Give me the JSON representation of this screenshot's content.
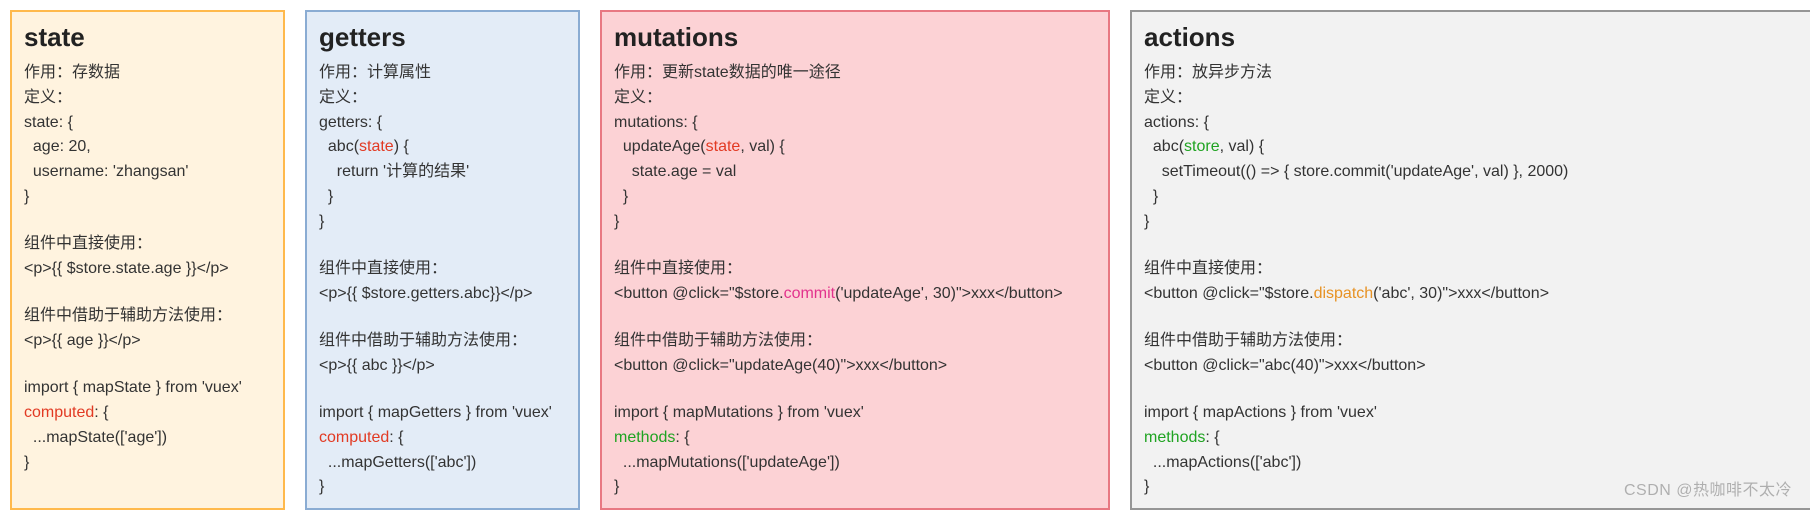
{
  "watermark": "CSDN @热咖啡不太冷",
  "cards": {
    "state": {
      "title": "state",
      "purpose": "作用：存数据",
      "define_label": "定义：",
      "def1": "state: {",
      "def2": "  age: 20,",
      "def3": "  username: 'zhangsan'",
      "def4": "}",
      "direct_label": "组件中直接使用：",
      "direct_code": "<p>{{ $store.state.age }}</p>",
      "helper_label": "组件中借助于辅助方法使用：",
      "helper_code": "<p>{{ age }}</p>",
      "import_code": "import { mapState } from 'vuex'",
      "computed": "computed",
      "computed_after": ": {",
      "map_code": "  ...mapState(['age'])",
      "close": "}"
    },
    "getters": {
      "title": "getters",
      "purpose": "作用：计算属性",
      "define_label": "定义：",
      "def1": "getters: {",
      "def2a": "  abc(",
      "def2b": "state",
      "def2c": ") {",
      "def3": "    return '计算的结果'",
      "def4": "  }",
      "def5": "}",
      "direct_label": "组件中直接使用：",
      "direct_code": "<p>{{ $store.getters.abc}}</p>",
      "helper_label": "组件中借助于辅助方法使用：",
      "helper_code": "<p>{{ abc }}</p>",
      "import_code": "import { mapGetters } from 'vuex'",
      "computed": "computed",
      "computed_after": ": {",
      "map_code": "  ...mapGetters(['abc'])",
      "close": "}"
    },
    "mutations": {
      "title": "mutations",
      "purpose": "作用：更新state数据的唯一途径",
      "define_label": "定义：",
      "def1": "mutations: {",
      "def2a": "  updateAge(",
      "def2b": "state",
      "def2c": ", val) {",
      "def3": "    state.age = val",
      "def4": "  }",
      "def5": "}",
      "direct_label": "组件中直接使用：",
      "direct_a": "<button @click=\"$store.",
      "direct_b": "commit",
      "direct_c": "('updateAge', 30)\">xxx</button>",
      "helper_label": "组件中借助于辅助方法使用：",
      "helper_code": "<button @click=\"updateAge(40)\">xxx</button>",
      "import_code": "import { mapMutations } from 'vuex'",
      "methods": "methods",
      "methods_after": ": {",
      "map_code": "  ...mapMutations(['updateAge'])",
      "close": "}"
    },
    "actions": {
      "title": "actions",
      "purpose": "作用：放异步方法",
      "define_label": "定义：",
      "def1": "actions: {",
      "def2a": "  abc(",
      "def2b": "store",
      "def2c": ", val) {",
      "def3": "    setTimeout(() => { store.commit('updateAge', val) }, 2000)",
      "def4": "  }",
      "def5": "}",
      "direct_label": "组件中直接使用：",
      "direct_a": "<button @click=\"$store.",
      "direct_b": "dispatch",
      "direct_c": "('abc', 30)\">xxx</button>",
      "helper_label": "组件中借助于辅助方法使用：",
      "helper_code": "<button @click=\"abc(40)\">xxx</button>",
      "import_code": "import { mapActions } from 'vuex'",
      "methods": "methods",
      "methods_after": ": {",
      "map_code": "  ...mapActions(['abc'])",
      "close": "}"
    }
  }
}
